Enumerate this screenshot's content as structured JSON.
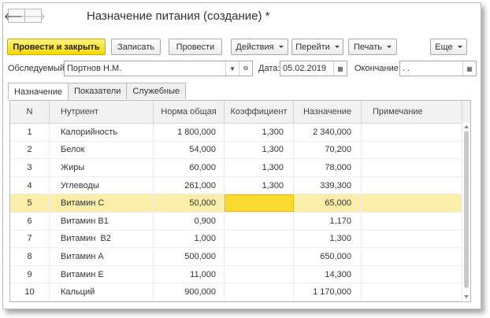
{
  "window": {
    "title": "Назначение питания (создание) *"
  },
  "nav": {
    "back_icon": "arrow-left-icon",
    "forward_icon": "arrow-right-icon",
    "back": "🡐",
    "forward": "🡒"
  },
  "toolbar": {
    "post_close": "Провести и закрыть",
    "save": "Записать",
    "post": "Провести",
    "actions": "Действия",
    "goto": "Перейти",
    "print": "Печать",
    "more": "Еще"
  },
  "form": {
    "patient_label": "Обследуемый:",
    "patient_value": "Портнов Н.М.",
    "date_label": "Дата:",
    "date_value": "05.02.2019",
    "end_label": "Окончание:",
    "end_value": " .  ."
  },
  "tabs": [
    "Назначение",
    "Показатели",
    "Служебные"
  ],
  "table": {
    "columns": [
      "N",
      "Нутриент",
      "Норма общая",
      "Коэффициент",
      "Назначение",
      "Примечание"
    ],
    "rows": [
      {
        "n": "1",
        "name": "Калорийность",
        "norm": "1 800,000",
        "coef": "1,300",
        "assign": "2 340,000",
        "note": ""
      },
      {
        "n": "2",
        "name": "Белок",
        "norm": "54,000",
        "coef": "1,300",
        "assign": "70,200",
        "note": ""
      },
      {
        "n": "3",
        "name": "Жиры",
        "norm": "60,000",
        "coef": "1,300",
        "assign": "78,000",
        "note": ""
      },
      {
        "n": "4",
        "name": "Углеводы",
        "norm": "261,000",
        "coef": "1,300",
        "assign": "339,300",
        "note": ""
      },
      {
        "n": "5",
        "name": "Витамин С",
        "norm": "50,000",
        "coef": "",
        "assign": "65,000",
        "note": ""
      },
      {
        "n": "6",
        "name": "Витамин В1",
        "norm": "0,900",
        "coef": "",
        "assign": "1,170",
        "note": ""
      },
      {
        "n": "7",
        "name": "Витамин  В2",
        "norm": "1,000",
        "coef": "",
        "assign": "1,300",
        "note": ""
      },
      {
        "n": "8",
        "name": "Витамин А",
        "norm": "500,000",
        "coef": "",
        "assign": "650,000",
        "note": ""
      },
      {
        "n": "9",
        "name": "Витамин Е",
        "norm": "11,000",
        "coef": "",
        "assign": "14,300",
        "note": ""
      },
      {
        "n": "10",
        "name": "Кальций",
        "norm": "900,000",
        "coef": "",
        "assign": "1 170,000",
        "note": ""
      }
    ],
    "selected_row": 5
  },
  "colors": {
    "primary_button": "#f7d800",
    "selected_row": "#fbeea9",
    "current_cell": "#fada2d"
  }
}
